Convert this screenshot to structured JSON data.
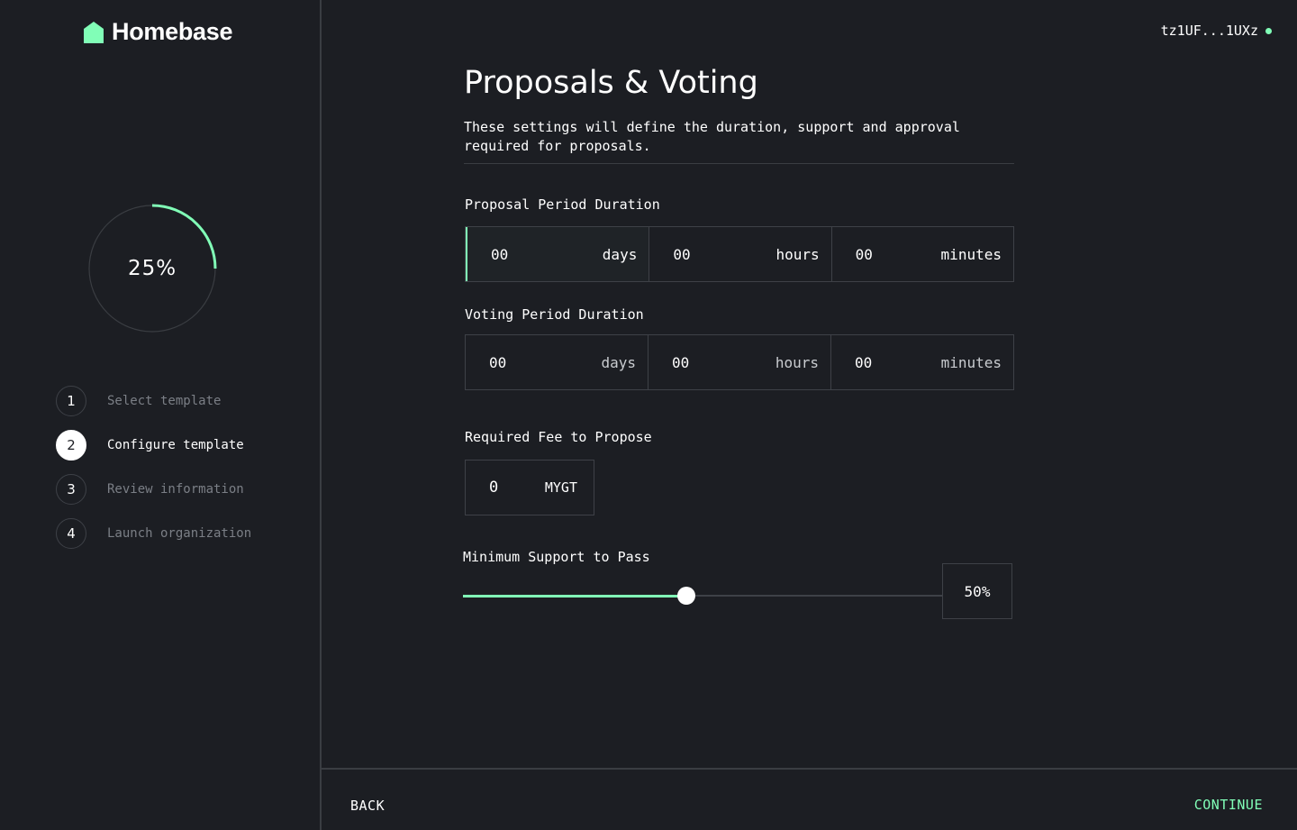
{
  "app": {
    "name": "Homebase"
  },
  "wallet": {
    "address": "tz1UF...1UXz"
  },
  "progress": {
    "value": 0.25,
    "label": "25%"
  },
  "steps": [
    {
      "num": "1",
      "label": "Select template",
      "active": false
    },
    {
      "num": "2",
      "label": "Configure template",
      "active": true
    },
    {
      "num": "3",
      "label": "Review information",
      "active": false
    },
    {
      "num": "4",
      "label": "Launch organization",
      "active": false
    }
  ],
  "page": {
    "title": "Proposals & Voting",
    "description": "These settings will define the duration, support and approval required for proposals."
  },
  "proposal_period": {
    "label": "Proposal Period Duration",
    "days": "00",
    "days_unit": "days",
    "hours": "00",
    "hours_unit": "hours",
    "minutes": "00",
    "minutes_unit": "minutes"
  },
  "voting_period": {
    "label": "Voting Period Duration",
    "days": "00",
    "days_unit": "days",
    "hours": "00",
    "hours_unit": "hours",
    "minutes": "00",
    "minutes_unit": "minutes"
  },
  "fee": {
    "label": "Required Fee to Propose",
    "value": "0",
    "unit": "MYGT"
  },
  "support": {
    "label": "Minimum Support to Pass",
    "value": 0.5,
    "display": "50%"
  },
  "footer": {
    "back_label": "BACK",
    "continue_label": "CONTINUE"
  },
  "colors": {
    "accent": "#81feb7",
    "background": "#1c1e23",
    "border": "#3e4147"
  }
}
